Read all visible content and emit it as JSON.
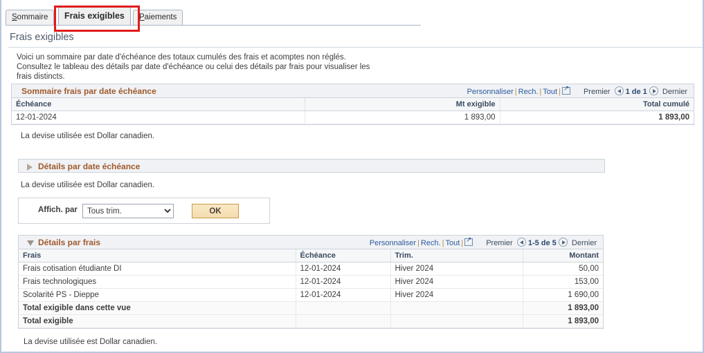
{
  "tabs": [
    {
      "name": "tab-sommaire",
      "label": "Sommaire",
      "accesskey": "S",
      "rest": "ommaire",
      "active": false
    },
    {
      "name": "tab-frais-exigibles",
      "label": "Frais exigibles",
      "active": true
    },
    {
      "name": "tab-paiements",
      "label": "Paiements",
      "accesskey": "P",
      "rest": "aiements",
      "active": false
    }
  ],
  "page": {
    "title": "Frais exigibles",
    "intro_line1": "Voici un sommaire par date d'échéance des totaux cumulés des frais et acomptes non réglés.",
    "intro_line2": "Consultez le tableau des détails par date d'échéance ou celui des détails par frais pour visualiser les",
    "intro_line3": "frais distincts."
  },
  "nav_labels": {
    "personnaliser": "Personnaliser",
    "rech": "Rech.",
    "tout": "Tout",
    "premier": "Premier",
    "dernier": "Dernier",
    "expand_icon": "expand-grid-icon"
  },
  "summary_grid": {
    "title": "Sommaire frais par date échéance",
    "page_indicator": "1 de 1",
    "columns": [
      "Échéance",
      "Mt exigible",
      "Total cumulé"
    ],
    "rows": [
      {
        "echeance": "12-01-2024",
        "mt_exigible": "1 893,00",
        "total_cumule": "1 893,00"
      }
    ],
    "currency_note": "La devise utilisée est Dollar canadien."
  },
  "details_date_section": {
    "title": "Détails par date échéance",
    "collapsed": true,
    "currency_note": "La devise utilisée est Dollar canadien."
  },
  "filter": {
    "label": "Affich. par",
    "selected": "Tous trim.",
    "options": [
      "Tous trim."
    ],
    "ok_label": "OK"
  },
  "details_fees_grid": {
    "title": "Détails par frais",
    "collapsed": false,
    "page_indicator": "1-5 de 5",
    "columns": [
      "Frais",
      "Échéance",
      "Trim.",
      "Montant"
    ],
    "rows": [
      {
        "frais": "Frais cotisation étudiante DI",
        "echeance": "12-01-2024",
        "trim": "Hiver 2024",
        "montant": "50,00",
        "bold": false
      },
      {
        "frais": "Frais technologiques",
        "echeance": "12-01-2024",
        "trim": "Hiver 2024",
        "montant": "153,00",
        "bold": false
      },
      {
        "frais": "Scolarité PS - Dieppe",
        "echeance": "12-01-2024",
        "trim": "Hiver 2024",
        "montant": "1 690,00",
        "bold": false
      },
      {
        "frais": "Total exigible dans cette vue",
        "echeance": "",
        "trim": "",
        "montant": "1 893,00",
        "bold": true
      },
      {
        "frais": "Total exigible",
        "echeance": "",
        "trim": "",
        "montant": "1 893,00",
        "bold": true
      }
    ],
    "currency_note": "La devise utilisée est Dollar canadien."
  },
  "colors": {
    "section_title": "#a05a2c",
    "link": "#2c5a9e",
    "highlight_box": "#e01b1b",
    "ok_button": "#f3dcae"
  }
}
